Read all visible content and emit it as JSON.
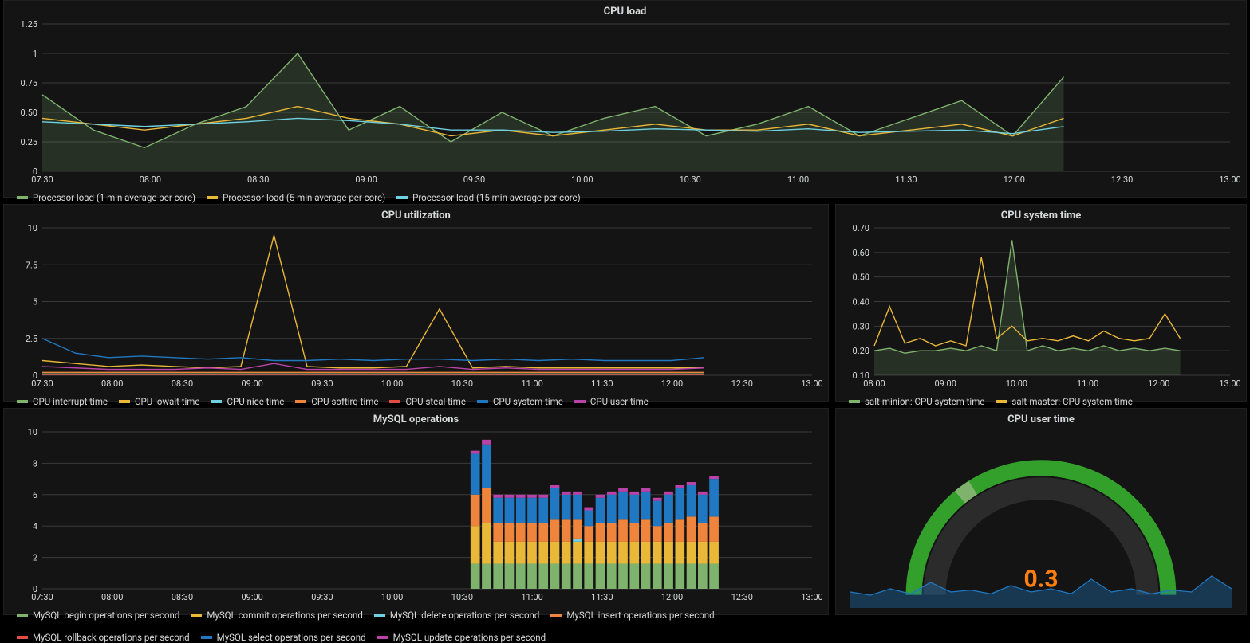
{
  "panels": {
    "cpu_load": {
      "title": "CPU load"
    },
    "cpu_util": {
      "title": "CPU utilization"
    },
    "cpu_sys_time": {
      "title": "CPU system time"
    },
    "mysql_ops": {
      "title": "MySQL operations"
    },
    "cpu_user_time": {
      "title": "CPU user time"
    }
  },
  "gauge": {
    "value": "0.3"
  },
  "chart_data": [
    {
      "id": "cpu_load",
      "type": "line",
      "title": "CPU load",
      "xlabel": "",
      "ylabel": "",
      "ylim": [
        0,
        1.25
      ],
      "yticks": [
        0,
        0.25,
        0.5,
        0.75,
        1.0,
        1.25
      ],
      "xticks": [
        "07:30",
        "08:00",
        "08:30",
        "09:00",
        "09:30",
        "10:00",
        "10:30",
        "11:00",
        "11:30",
        "12:00",
        "12:30",
        "13:00"
      ],
      "x": [
        "07:15",
        "07:30",
        "07:45",
        "08:00",
        "08:15",
        "08:30",
        "08:45",
        "09:00",
        "09:15",
        "09:30",
        "09:45",
        "10:00",
        "10:15",
        "10:30",
        "10:45",
        "11:00",
        "11:15",
        "11:30",
        "11:45",
        "12:00",
        "12:15"
      ],
      "series": [
        {
          "name": "Processor load (1 min average per core)",
          "color": "#7eb26d",
          "values": [
            0.65,
            0.35,
            0.2,
            0.4,
            0.55,
            1.0,
            0.35,
            0.55,
            0.25,
            0.5,
            0.3,
            0.45,
            0.55,
            0.3,
            0.4,
            0.55,
            0.3,
            0.45,
            0.6,
            0.3,
            0.8
          ]
        },
        {
          "name": "Processor load (5 min average per core)",
          "color": "#eab839",
          "values": [
            0.45,
            0.4,
            0.35,
            0.4,
            0.45,
            0.55,
            0.45,
            0.4,
            0.3,
            0.35,
            0.3,
            0.35,
            0.4,
            0.35,
            0.35,
            0.4,
            0.3,
            0.35,
            0.4,
            0.3,
            0.45
          ]
        },
        {
          "name": "Processor load (15 min average per core)",
          "color": "#6ed0e0",
          "values": [
            0.42,
            0.4,
            0.38,
            0.4,
            0.42,
            0.45,
            0.43,
            0.4,
            0.35,
            0.35,
            0.33,
            0.34,
            0.36,
            0.35,
            0.34,
            0.36,
            0.33,
            0.34,
            0.35,
            0.32,
            0.38
          ]
        }
      ]
    },
    {
      "id": "cpu_util",
      "type": "line",
      "title": "CPU utilization",
      "ylim": [
        0,
        10.0
      ],
      "yticks": [
        0,
        2.5,
        5.0,
        7.5,
        10.0
      ],
      "xticks": [
        "07:30",
        "08:00",
        "08:30",
        "09:00",
        "09:30",
        "10:00",
        "10:30",
        "11:00",
        "11:30",
        "12:00",
        "12:30",
        "13:00"
      ],
      "x": [
        "07:15",
        "07:30",
        "07:45",
        "08:00",
        "08:15",
        "08:30",
        "08:45",
        "09:00",
        "09:15",
        "09:30",
        "09:45",
        "10:00",
        "10:15",
        "10:30",
        "10:45",
        "11:00",
        "11:15",
        "11:30",
        "11:45",
        "12:00",
        "12:15"
      ],
      "series": [
        {
          "name": "CPU interrupt time",
          "color": "#7eb26d",
          "values": [
            0.1,
            0.1,
            0.1,
            0.1,
            0.1,
            0.1,
            0.1,
            0.1,
            0.1,
            0.1,
            0.1,
            0.1,
            0.1,
            0.1,
            0.1,
            0.1,
            0.1,
            0.1,
            0.1,
            0.1,
            0.1
          ]
        },
        {
          "name": "CPU iowait time",
          "color": "#eab839",
          "values": [
            1.0,
            0.8,
            0.6,
            0.7,
            0.6,
            0.5,
            0.6,
            9.5,
            0.6,
            0.5,
            0.5,
            0.6,
            4.5,
            0.5,
            0.6,
            0.5,
            0.5,
            0.5,
            0.5,
            0.5,
            0.5
          ]
        },
        {
          "name": "CPU nice time",
          "color": "#6ed0e0",
          "values": [
            0.05,
            0.05,
            0.05,
            0.05,
            0.05,
            0.05,
            0.05,
            0.05,
            0.05,
            0.05,
            0.05,
            0.05,
            0.05,
            0.05,
            0.05,
            0.05,
            0.05,
            0.05,
            0.05,
            0.05,
            0.05
          ]
        },
        {
          "name": "CPU softirq time",
          "color": "#ef843c",
          "values": [
            0.2,
            0.2,
            0.2,
            0.2,
            0.2,
            0.2,
            0.2,
            0.2,
            0.2,
            0.2,
            0.2,
            0.2,
            0.2,
            0.2,
            0.2,
            0.2,
            0.2,
            0.2,
            0.2,
            0.2,
            0.2
          ]
        },
        {
          "name": "CPU steal time",
          "color": "#e24d42",
          "values": [
            0.05,
            0.05,
            0.05,
            0.05,
            0.05,
            0.05,
            0.05,
            0.05,
            0.05,
            0.05,
            0.05,
            0.05,
            0.05,
            0.05,
            0.05,
            0.05,
            0.05,
            0.05,
            0.05,
            0.05,
            0.05
          ]
        },
        {
          "name": "CPU system time",
          "color": "#1f78c1",
          "values": [
            2.5,
            1.5,
            1.2,
            1.3,
            1.2,
            1.1,
            1.2,
            1.0,
            1.0,
            1.1,
            1.0,
            1.1,
            1.1,
            1.0,
            1.1,
            1.0,
            1.1,
            1.0,
            1.0,
            1.0,
            1.2
          ]
        },
        {
          "name": "CPU user time",
          "color": "#ba43a9",
          "values": [
            0.6,
            0.5,
            0.4,
            0.4,
            0.4,
            0.5,
            0.4,
            0.8,
            0.4,
            0.4,
            0.4,
            0.4,
            0.6,
            0.4,
            0.5,
            0.4,
            0.4,
            0.4,
            0.4,
            0.4,
            0.5
          ]
        }
      ]
    },
    {
      "id": "cpu_sys_time",
      "type": "line",
      "title": "CPU system time",
      "ylim": [
        0.1,
        0.7
      ],
      "yticks": [
        0.1,
        0.2,
        0.3,
        0.4,
        0.5,
        0.6,
        0.7
      ],
      "xticks": [
        "08:00",
        "09:00",
        "10:00",
        "11:00",
        "12:00",
        "13:00"
      ],
      "x": [
        "07:15",
        "07:30",
        "07:45",
        "08:00",
        "08:15",
        "08:30",
        "08:45",
        "09:00",
        "09:15",
        "09:30",
        "09:45",
        "10:00",
        "10:15",
        "10:30",
        "10:45",
        "11:00",
        "11:15",
        "11:30",
        "11:45",
        "12:00",
        "12:15"
      ],
      "series": [
        {
          "name": "salt-minion: CPU system time",
          "color": "#7eb26d",
          "values": [
            0.2,
            0.21,
            0.19,
            0.2,
            0.2,
            0.21,
            0.2,
            0.22,
            0.2,
            0.65,
            0.2,
            0.22,
            0.2,
            0.21,
            0.2,
            0.22,
            0.2,
            0.21,
            0.2,
            0.21,
            0.2
          ]
        },
        {
          "name": "salt-master: CPU system time",
          "color": "#eab839",
          "values": [
            0.22,
            0.38,
            0.23,
            0.25,
            0.22,
            0.24,
            0.22,
            0.58,
            0.25,
            0.3,
            0.24,
            0.25,
            0.24,
            0.26,
            0.24,
            0.28,
            0.25,
            0.24,
            0.25,
            0.35,
            0.25
          ]
        }
      ]
    },
    {
      "id": "mysql_ops",
      "type": "bar",
      "title": "MySQL operations",
      "ylim": [
        0,
        10
      ],
      "yticks": [
        0,
        2,
        4,
        6,
        8,
        10
      ],
      "xticks": [
        "07:30",
        "08:00",
        "08:30",
        "09:00",
        "09:30",
        "10:00",
        "10:30",
        "11:00",
        "11:30",
        "12:00",
        "12:30",
        "13:00"
      ],
      "categories": [
        "10:35",
        "10:40",
        "10:45",
        "10:50",
        "10:55",
        "11:00",
        "11:05",
        "11:10",
        "11:15",
        "11:20",
        "11:25",
        "11:30",
        "11:35",
        "11:40",
        "11:45",
        "11:50",
        "11:55",
        "12:00",
        "12:05",
        "12:10",
        "12:15",
        "12:20"
      ],
      "stacked": true,
      "series": [
        {
          "name": "MySQL begin operations per second",
          "color": "#7eb26d",
          "values": [
            1.6,
            1.6,
            1.6,
            1.6,
            1.6,
            1.6,
            1.6,
            1.6,
            1.6,
            1.6,
            1.6,
            1.6,
            1.6,
            1.6,
            1.6,
            1.6,
            1.6,
            1.6,
            1.6,
            1.6,
            1.6,
            1.6
          ]
        },
        {
          "name": "MySQL commit operations per second",
          "color": "#eab839",
          "values": [
            2.4,
            2.6,
            1.4,
            1.4,
            1.4,
            1.4,
            1.4,
            1.4,
            1.4,
            1.4,
            1.4,
            1.4,
            1.4,
            1.4,
            1.4,
            1.4,
            1.4,
            1.4,
            1.4,
            1.4,
            1.4,
            1.4
          ]
        },
        {
          "name": "MySQL delete operations per second",
          "color": "#6ed0e0",
          "values": [
            0,
            0,
            0,
            0,
            0,
            0,
            0,
            0,
            0,
            0.2,
            0,
            0,
            0,
            0,
            0,
            0,
            0,
            0,
            0,
            0,
            0,
            0
          ]
        },
        {
          "name": "MySQL insert operations per second",
          "color": "#ef843c",
          "values": [
            2.0,
            2.2,
            1.2,
            1.2,
            1.2,
            1.2,
            1.2,
            1.4,
            1.4,
            1.2,
            1.0,
            1.2,
            1.2,
            1.4,
            1.2,
            1.4,
            1.0,
            1.2,
            1.4,
            1.6,
            1.2,
            1.6
          ]
        },
        {
          "name": "MySQL rollback operations per second",
          "color": "#e24d42",
          "values": [
            0,
            0,
            0,
            0,
            0,
            0,
            0,
            0,
            0,
            0,
            0,
            0,
            0,
            0,
            0,
            0,
            0,
            0,
            0,
            0,
            0,
            0
          ]
        },
        {
          "name": "MySQL select operations per second",
          "color": "#1f78c1",
          "values": [
            2.6,
            2.8,
            1.6,
            1.6,
            1.6,
            1.6,
            1.6,
            2.0,
            1.6,
            1.6,
            1.0,
            1.6,
            1.8,
            1.8,
            1.8,
            1.8,
            1.6,
            1.8,
            2.0,
            2.0,
            1.8,
            2.4
          ]
        },
        {
          "name": "MySQL update operations per second",
          "color": "#ba43a9",
          "values": [
            0.2,
            0.3,
            0.2,
            0.2,
            0.2,
            0.2,
            0.2,
            0.2,
            0.2,
            0.2,
            0.2,
            0.2,
            0.2,
            0.2,
            0.2,
            0.2,
            0.2,
            0.2,
            0.2,
            0.2,
            0.2,
            0.2
          ]
        }
      ]
    },
    {
      "id": "cpu_user_time",
      "type": "gauge",
      "title": "CPU user time",
      "value": 0.3,
      "min": 0,
      "max": 1,
      "spark": [
        0.25,
        0.2,
        0.3,
        0.22,
        0.4,
        0.25,
        0.28,
        0.22,
        0.35,
        0.25,
        0.3,
        0.22,
        0.45,
        0.25,
        0.3,
        0.22,
        0.28,
        0.25,
        0.5,
        0.3
      ]
    }
  ]
}
